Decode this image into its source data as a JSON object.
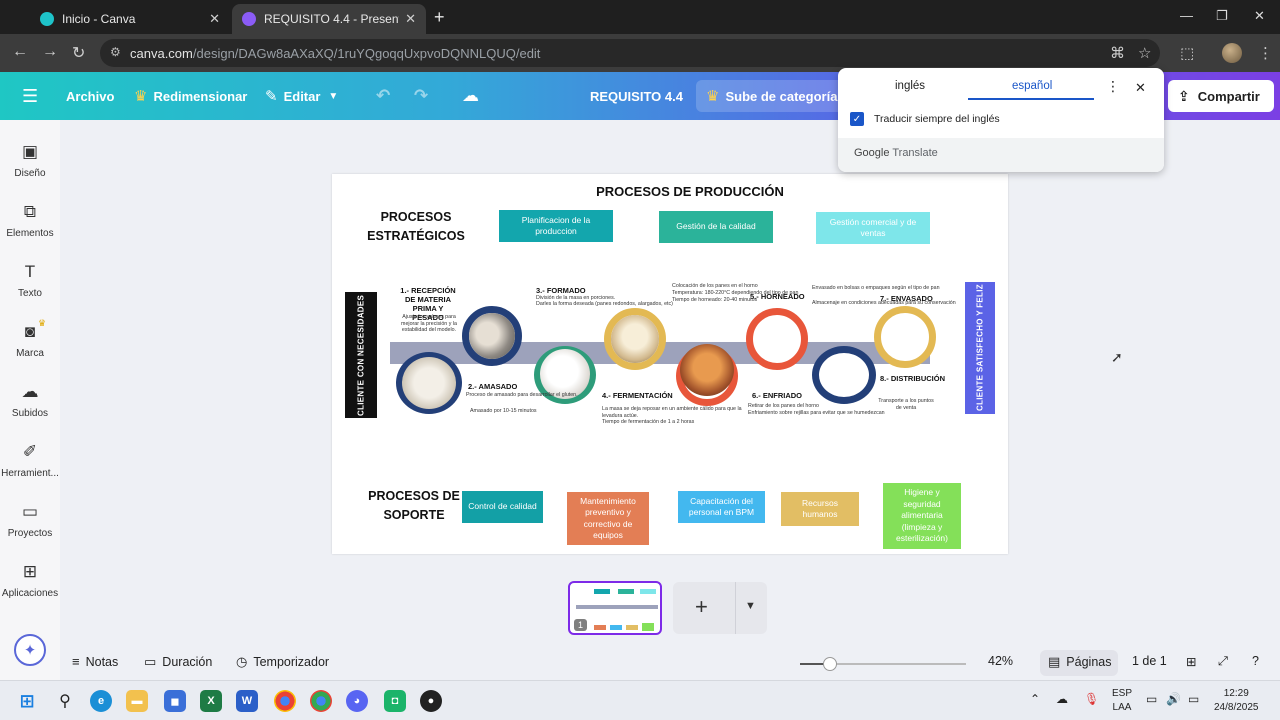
{
  "browser": {
    "tabs": [
      {
        "label": "Inicio - Canva",
        "active": false
      },
      {
        "label": "REQUISITO 4.4 - Presentación",
        "active": true
      }
    ],
    "url": {
      "host": "canva.com",
      "path": "/design/DAGw8aAXaXQ/1ruYQgoqqUxpvoDQNNLQUQ/edit"
    }
  },
  "toolbar": {
    "archivo": "Archivo",
    "redimensionar": "Redimensionar",
    "editar": "Editar",
    "doc_title": "REQUISITO 4.4",
    "upgrade": "Sube de categoría a",
    "share": "Compartir"
  },
  "sidebar": {
    "items": [
      {
        "label": "Diseño",
        "icon": "layout-icon"
      },
      {
        "label": "Elementos",
        "icon": "shapes-icon"
      },
      {
        "label": "Texto",
        "icon": "text-icon"
      },
      {
        "label": "Marca",
        "icon": "brand-icon"
      },
      {
        "label": "Subidos",
        "icon": "upload-icon"
      },
      {
        "label": "Herramient...",
        "icon": "tools-icon"
      },
      {
        "label": "Proyectos",
        "icon": "folder-icon"
      },
      {
        "label": "Aplicaciones",
        "icon": "apps-icon"
      }
    ]
  },
  "translate": {
    "tab_source": "inglés",
    "tab_target": "español",
    "always_translate": "Traducir siempre del inglés",
    "footer_brand": "Google",
    "footer_product": "Translate"
  },
  "slide": {
    "title": "PROCESOS DE PRODUCCIÓN",
    "strategic_title_1": "PROCESOS",
    "strategic_title_2": "ESTRATÉGICOS",
    "strategic_boxes": [
      "Planificacion de la produccion",
      "Gestión de la calidad",
      "Gestión comercial y de ventas"
    ],
    "support_title_1": "PROCESOS DE",
    "support_title_2": "SOPORTE",
    "support_boxes": [
      "Control de calidad",
      "Mantenimiento preventivo y correctivo de equipos",
      "Capacitación del personal en BPM",
      "Recursos humanos",
      "Higiene y seguridad alimentaria (limpieza y esterilización)"
    ],
    "left_bar": "CLIENTE CON NECESIDADES",
    "right_bar": "CLIENTE SATISFECHO Y FELIZ",
    "steps": {
      "s1": "1.- RECEPCIÓN DE MATERIA PRIMA Y PESADO",
      "s2": "2.- AMASADO",
      "s3": "3.- FORMADO",
      "s4": "4.- FERMENTACIÓN",
      "s5": "5.- HORNEADO",
      "s6": "6.- ENFRIADO",
      "s7": "7.- ENVASADO",
      "s8": "8.- DISTRIBUCIÓN"
    },
    "notes": {
      "n1": "Ajuste los valores para mejorar la precisión y la estabilidad del modelo.",
      "n2a": "Proceso de amasado para desarrollar el gluten.",
      "n2b": "Amasado por 10-15 minutos",
      "n3a": "División de la masa en porciones.",
      "n3b": "Darles la forma deseada (panes redondos, alargados, etc)",
      "n4a": "La masa se deja reposar en un ambiente cálido para que la levadura actúe.",
      "n4b": "Tiempo de fermentación de 1 a 2 horas",
      "n5a": "Colocación de los panes en el horno",
      "n5b": "Temperatura: 180-220°C dependiendo del tipo de pan",
      "n5c": "Tiempo de horneado: 20-40 minutos",
      "n6a": "Retirar de los panes del horno",
      "n6b": "Enfriamiento sobre rejillas para evitar que se humedezcan",
      "n7a": "Envasado en bolsas o empaques según el tipo de pan",
      "n7b": "Almacenaje en condiciones adecuadas para su conservación",
      "n8": "Transporte a los puntos de venta"
    }
  },
  "pages": {
    "thumb_number": "1"
  },
  "bottombar": {
    "notes": "Notas",
    "duration": "Duración",
    "timer": "Temporizador",
    "zoom_pct": "42%",
    "zoom_value": 42,
    "pages": "Páginas",
    "page_of": "1 de 1"
  },
  "taskbar": {
    "lang_1": "ESP",
    "lang_2": "LAA",
    "time": "12:29",
    "date": "24/8/2025"
  },
  "colors": {
    "teal_dark": "#13a6ad",
    "teal_mid": "#2bb39a",
    "teal_light": "#7ee6ea",
    "road": "#9da2bb",
    "blue_bar": "#5b63e6",
    "black_bar": "#111111",
    "orange": "#e8563a",
    "gold": "#e3b953",
    "navy": "#233f78",
    "green": "#2e9c7a",
    "support_teal": "#13a0a6",
    "support_orange": "#e37e55",
    "support_sky": "#43b8ef",
    "support_sand": "#e2be64",
    "support_green": "#84e059",
    "canva_purple": "#7d2ae8"
  }
}
